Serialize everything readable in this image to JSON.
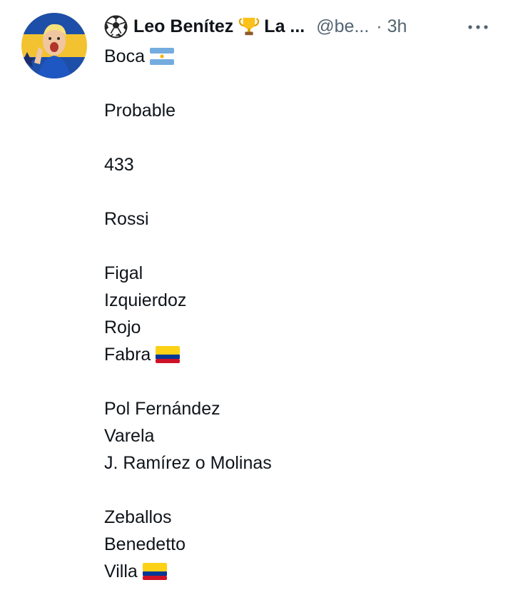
{
  "tweet": {
    "author_name": "Leo Benítez",
    "author_name_suffix": "La ...",
    "handle": "@be...",
    "time": "· 3h",
    "more_label": "More"
  },
  "body_lines": [
    {
      "text": "Boca",
      "flag": "argentina-flag"
    },
    {
      "text": ""
    },
    {
      "text": "Probable"
    },
    {
      "text": ""
    },
    {
      "text": "433"
    },
    {
      "text": ""
    },
    {
      "text": "Rossi"
    },
    {
      "text": ""
    },
    {
      "text": "Figal"
    },
    {
      "text": "Izquierdoz"
    },
    {
      "text": "Rojo"
    },
    {
      "text": "Fabra",
      "flag": "colombia-flag"
    },
    {
      "text": ""
    },
    {
      "text": "Pol Fernández"
    },
    {
      "text": "Varela"
    },
    {
      "text": "J. Ramírez o Molinas"
    },
    {
      "text": ""
    },
    {
      "text": "Zeballos"
    },
    {
      "text": "Benedetto"
    },
    {
      "text": "Villa",
      "flag": "colombia-flag"
    }
  ],
  "icons": {
    "name_prefix": "soccer-ball-icon",
    "name_middle": "trophy-icon",
    "more": "more-dots-icon"
  },
  "colors": {
    "text": "#0f1419",
    "secondary": "#536471",
    "argentina_blue": "#74acdf",
    "colombia_yellow": "#fcd116",
    "colombia_blue": "#003893",
    "colombia_red": "#ce1126"
  }
}
